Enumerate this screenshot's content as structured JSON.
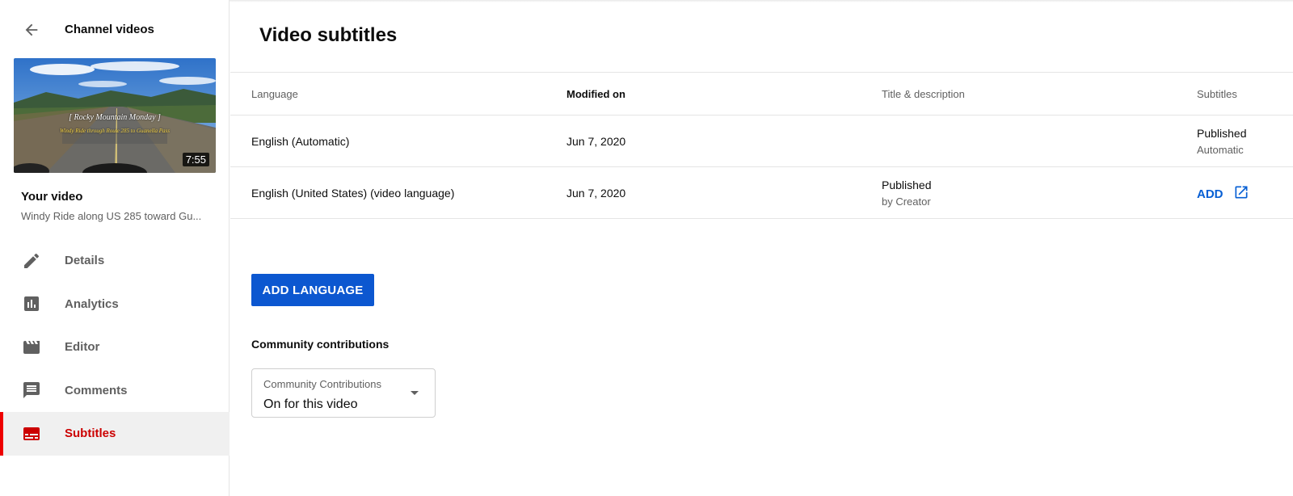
{
  "sidebar": {
    "back_label": "Channel videos",
    "thumbnail": {
      "title_line1": "[ Rocky Mountain Monday ]",
      "title_line2": "Windy Ride through Route 285 to Guanella Pass",
      "duration": "7:55"
    },
    "your_video_label": "Your video",
    "video_title": "Windy Ride along US 285 toward Gu...",
    "nav_items": [
      {
        "label": "Details",
        "icon": "pencil-icon",
        "active": false
      },
      {
        "label": "Analytics",
        "icon": "analytics-icon",
        "active": false
      },
      {
        "label": "Editor",
        "icon": "clapperboard-icon",
        "active": false
      },
      {
        "label": "Comments",
        "icon": "comment-icon",
        "active": false
      },
      {
        "label": "Subtitles",
        "icon": "subtitles-icon",
        "active": true
      }
    ]
  },
  "main": {
    "title": "Video subtitles",
    "table": {
      "headers": [
        "Language",
        "Modified on",
        "Title & description",
        "Subtitles"
      ],
      "rows": [
        {
          "language": "English (Automatic)",
          "modified": "Jun 7, 2020",
          "title_desc": "",
          "title_desc_sub": "",
          "subtitles": "Published",
          "subtitles_sub": "Automatic"
        },
        {
          "language": "English (United States) (video language)",
          "modified": "Jun 7, 2020",
          "title_desc": "Published",
          "title_desc_sub": "by Creator",
          "subtitles_action": "ADD"
        }
      ]
    },
    "add_language_button": "ADD LANGUAGE",
    "community": {
      "heading": "Community contributions",
      "select_label": "Community Contributions",
      "select_value": "On for this video"
    }
  },
  "colors": {
    "accent_blue": "#065fd4",
    "button_blue": "#0c57d0",
    "active_red": "#cc0000"
  }
}
